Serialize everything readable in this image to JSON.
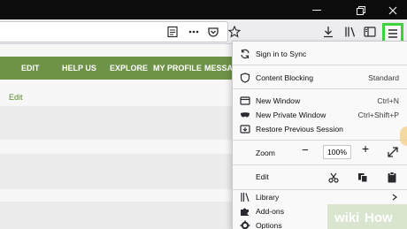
{
  "window": {
    "icons": [
      "minimize-icon",
      "restore-icon",
      "close-icon"
    ]
  },
  "toolbar": {
    "icons": [
      "reader-view-icon",
      "page-actions-icon",
      "pocket-icon",
      "bookmark-star-icon",
      "downloads-icon",
      "library-icon",
      "sidebar-icon",
      "hamburger-menu-icon"
    ]
  },
  "site_nav": {
    "items": [
      "EDIT",
      "HELP US",
      "EXPLORE",
      "MY PROFILE",
      "MESSAG"
    ]
  },
  "page": {
    "edit_link": "Edit"
  },
  "menu": {
    "sync": "Sign in to Sync",
    "content_blocking": "Content Blocking",
    "content_blocking_value": "Standard",
    "new_window": "New Window",
    "new_window_shortcut": "Ctrl+N",
    "new_private_window": "New Private Window",
    "new_private_window_shortcut": "Ctrl+Shift+P",
    "restore_session": "Restore Previous Session",
    "zoom_label": "Zoom",
    "zoom_minus": "−",
    "zoom_value": "100%",
    "zoom_plus": "+",
    "edit_label": "Edit",
    "library": "Library",
    "addons": "Add-ons",
    "options": "Options"
  },
  "colors": {
    "highlight": "#3ed13e",
    "nav_band": "#6f9249"
  }
}
